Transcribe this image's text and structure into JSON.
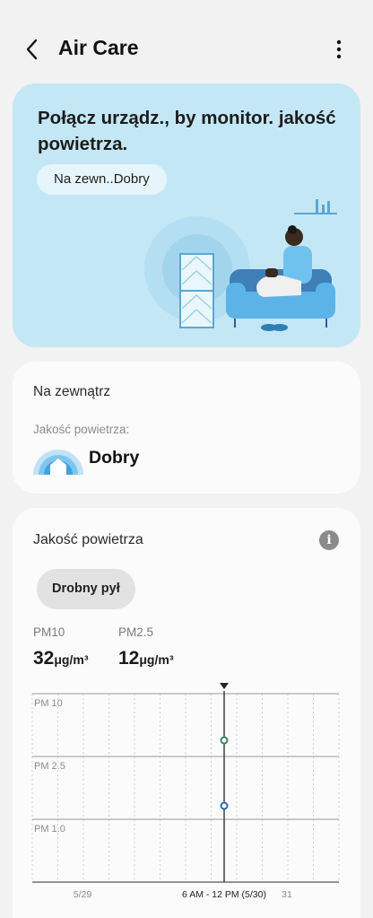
{
  "header": {
    "title": "Air Care"
  },
  "banner": {
    "title": "Połącz urządz., by monitor. jakość powietrza.",
    "pill": "Na zewn..Dobry"
  },
  "outdoor": {
    "title": "Na zewnątrz",
    "air_quality_label": "Jakość powietrza:",
    "air_quality_value": "Dobry"
  },
  "air_quality_card": {
    "title": "Jakość powietrza",
    "filter_chip": "Drobny pył",
    "pm10": {
      "label": "PM10",
      "value": "32",
      "unit": "μg/m³"
    },
    "pm25": {
      "label": "PM2.5",
      "value": "12",
      "unit": "μg/m³"
    }
  },
  "chart_data": {
    "type": "line",
    "bands": [
      "PM 10",
      "PM 2.5",
      "PM 1.0"
    ],
    "x_ticks": [
      "5/29",
      "6 AM - 12 PM (5/30)",
      "31"
    ],
    "selected_period": "6 AM - 12 PM (5/30)",
    "series": [
      {
        "name": "PM10",
        "values": [
          32
        ],
        "color": "#2f8a56"
      },
      {
        "name": "PM2.5",
        "values": [
          12
        ],
        "color": "#2a6ab0"
      }
    ],
    "grid": true
  },
  "colors": {
    "banner_bg": "#c4e7f5",
    "card_bg": "#fbfbfb",
    "page_bg": "#f2f2f2"
  }
}
